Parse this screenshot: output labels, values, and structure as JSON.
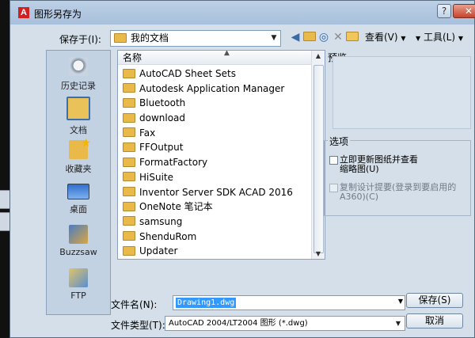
{
  "dialog": {
    "title": "图形另存为",
    "title_icon": "A",
    "help_glyph": "?",
    "close_glyph": "✕"
  },
  "save_in": {
    "label": "保存于(I):",
    "value": "我的文档"
  },
  "toolbar": {
    "view_label": "查看(V)",
    "tools_label": "工具(L)"
  },
  "places": [
    {
      "label": "历史记录",
      "icon": "history-icon"
    },
    {
      "label": "文档",
      "icon": "documents-icon"
    },
    {
      "label": "收藏夹",
      "icon": "favorites-icon"
    },
    {
      "label": "桌面",
      "icon": "desktop-icon"
    },
    {
      "label": "Buzzsaw",
      "icon": "buzzsaw-icon"
    },
    {
      "label": "FTP",
      "icon": "ftp-icon"
    }
  ],
  "file_list": {
    "column_name": "名称",
    "items": [
      "AutoCAD Sheet Sets",
      "Autodesk Application Manager",
      "Bluetooth",
      "download",
      "Fax",
      "FFOutput",
      "FormatFactory",
      "HiSuite",
      "Inventor Server SDK ACAD 2016",
      "OneNote 笔记本",
      "samsung",
      "ShenduRom",
      "Updater"
    ]
  },
  "preview": {
    "title": "预览"
  },
  "options": {
    "title": "选项",
    "update_thumbnail_line1": "立即更新图纸并查看",
    "update_thumbnail_line2": "缩略图(U)",
    "copy_design_line1": "复制设计提要(登录到要启用的",
    "copy_design_line2": "A360)(C)"
  },
  "file_name": {
    "label": "文件名(N):",
    "value": "Drawing1.dwg"
  },
  "file_type": {
    "label": "文件类型(T):",
    "value": "AutoCAD 2004/LT2004 图形 (*.dwg)"
  },
  "buttons": {
    "save": "保存(S)",
    "cancel": "取消"
  },
  "colors": {
    "title_accent": "#d21f1f",
    "selection": "#3399ff",
    "folder": "#e9b94a"
  }
}
